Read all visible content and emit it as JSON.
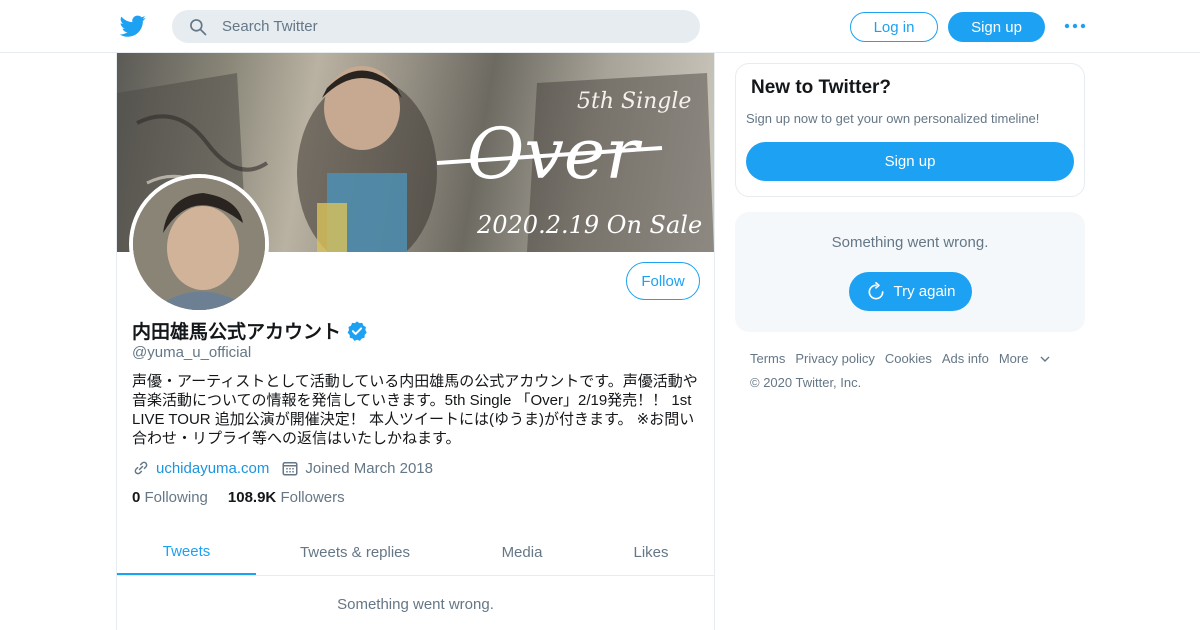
{
  "topbar": {
    "logo_icon": "twitter-bird-icon",
    "search_placeholder": "Search Twitter",
    "login_label": "Log in",
    "signup_label": "Sign up",
    "more_icon": "more-dots-icon"
  },
  "profile": {
    "banner_text": "5th Single Over 2020.2.19 On Sale",
    "follow_label": "Follow",
    "display_name": "内田雄馬公式アカウント",
    "verified_icon": "verified-badge-icon",
    "handle": "@yuma_u_official",
    "bio": "声優・アーティストとして活動している内田雄馬の公式アカウントです。声優活動や音楽活動についての情報を発信していきます。5th Single 「Over」2/19発売！！ 1st LIVE TOUR 追加公演が開催決定！ 本人ツイートには(ゆうま)が付きます。 ※お問い合わせ・リプライ等への返信はいたしかねます。",
    "website": "uchidayuma.com",
    "joined": "Joined March 2018",
    "following_count": "0",
    "following_label": "Following",
    "followers_count": "108.9K",
    "followers_label": "Followers"
  },
  "tabs": [
    {
      "label": "Tweets",
      "active": true
    },
    {
      "label": "Tweets & replies",
      "active": false
    },
    {
      "label": "Media",
      "active": false
    },
    {
      "label": "Likes",
      "active": false
    }
  ],
  "timeline": {
    "error_message": "Something went wrong."
  },
  "sidebar": {
    "new_title": "New to Twitter?",
    "new_subtitle": "Sign up now to get your own personalized timeline!",
    "signup_label": "Sign up",
    "error_message": "Something went wrong.",
    "try_again_label": "Try again"
  },
  "footer": {
    "links": [
      "Terms",
      "Privacy policy",
      "Cookies",
      "Ads info",
      "More"
    ],
    "copyright": "© 2020 Twitter, Inc."
  },
  "colors": {
    "accent": "#1da1f2",
    "secondary_text": "#657786",
    "border": "#e6ecf0"
  }
}
